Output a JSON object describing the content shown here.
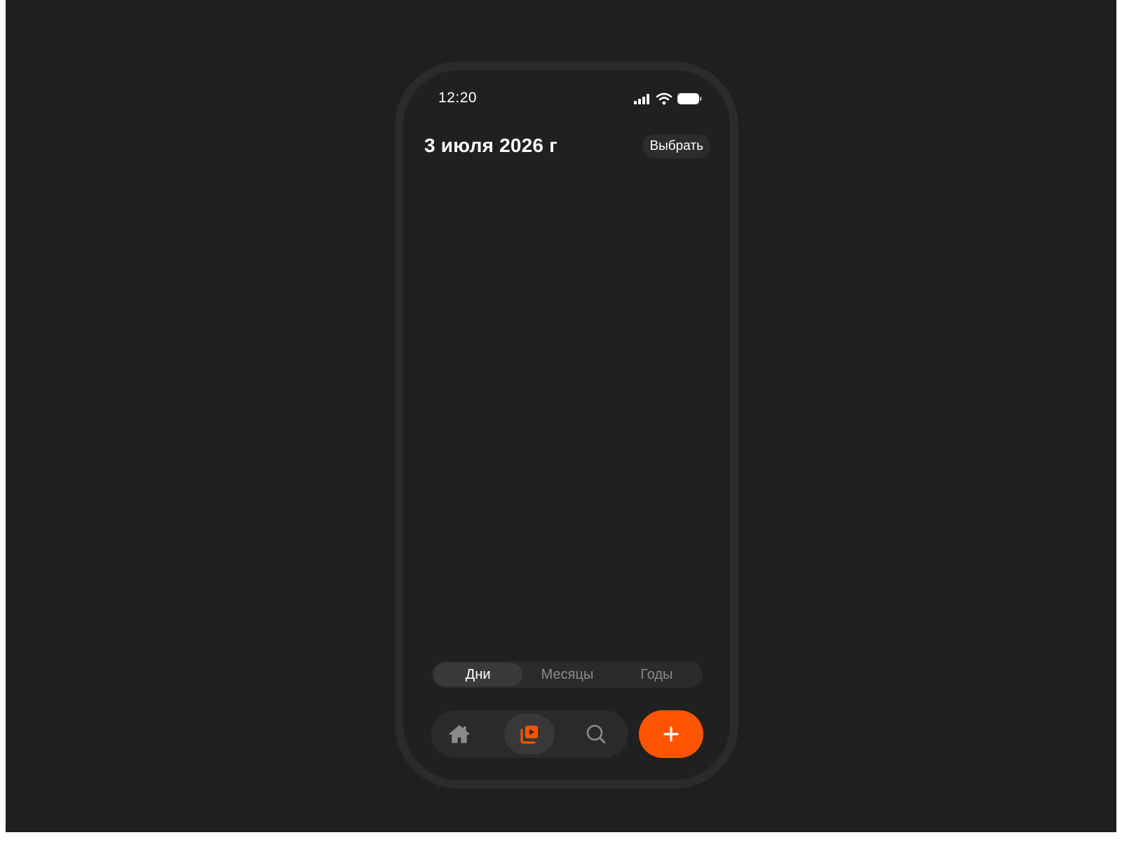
{
  "status_bar": {
    "time": "12:20",
    "icons": [
      "cellular-signal-icon",
      "wifi-icon",
      "battery-icon"
    ]
  },
  "header": {
    "title": "3 июля 2026 г",
    "select_label": "Выбрать"
  },
  "view_switcher": {
    "options": [
      {
        "label": "Дни",
        "selected": true
      },
      {
        "label": "Месяцы",
        "selected": false
      },
      {
        "label": "Годы",
        "selected": false
      }
    ]
  },
  "tab_bar": {
    "items": [
      {
        "icon": "home-icon",
        "active": false
      },
      {
        "icon": "media-library-icon",
        "active": true
      },
      {
        "icon": "search-icon",
        "active": false
      }
    ],
    "add_icon": "plus-icon"
  },
  "colors": {
    "accent": "#ff5500",
    "background": "#1f1f1f",
    "phone_surface": "#202020",
    "inactive_icon": "#8a8a8a",
    "text_primary": "#ffffff"
  }
}
